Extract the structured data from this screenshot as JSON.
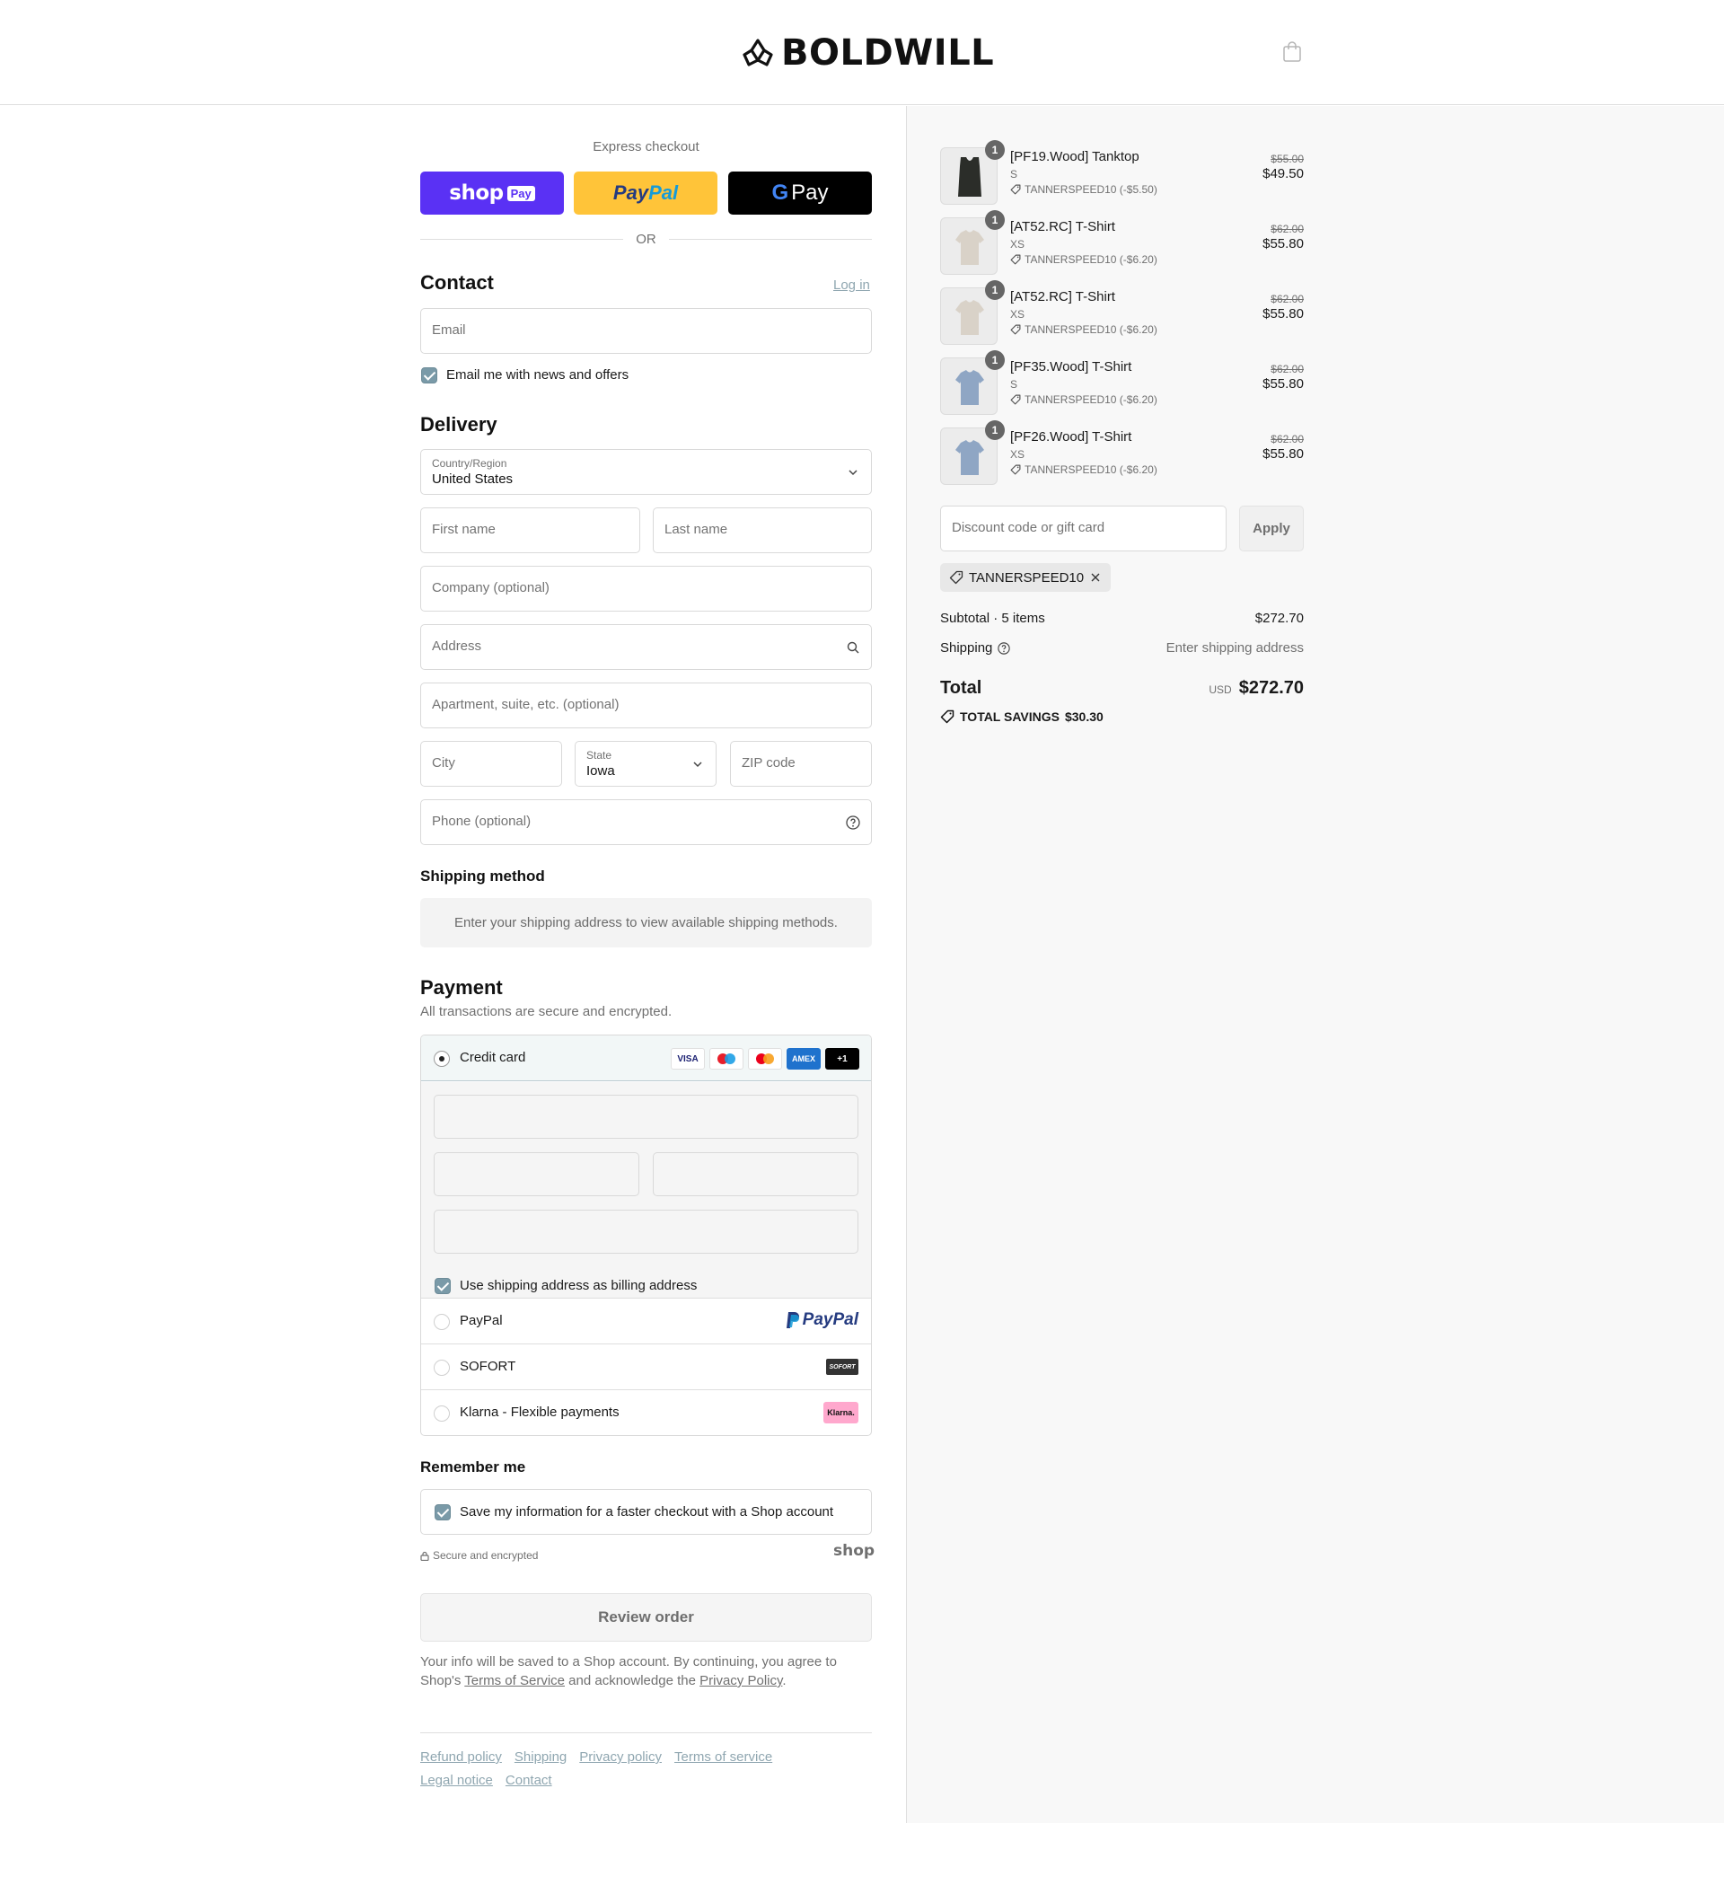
{
  "header": {
    "brand": "BOLDWILL",
    "cart_icon": "shopping-bag-icon"
  },
  "express": {
    "title": "Express checkout",
    "shop_pay": {
      "word": "shop",
      "tag": "Pay",
      "color": "#5a31f4"
    },
    "paypal": {
      "part1": "Pay",
      "part2": "Pal",
      "color": "#ffc439"
    },
    "gpay": {
      "g": "G",
      "word": "Pay",
      "color": "#000000"
    },
    "or": "OR"
  },
  "contact": {
    "title": "Contact",
    "login": "Log in",
    "email_placeholder": "Email",
    "newsletter_label": "Email me with news and offers"
  },
  "delivery": {
    "title": "Delivery",
    "country_label": "Country/Region",
    "country_value": "United States",
    "first_name": "First name",
    "last_name": "Last name",
    "company": "Company (optional)",
    "address": "Address",
    "apartment": "Apartment, suite, etc. (optional)",
    "city": "City",
    "state_label": "State",
    "state_value": "Iowa",
    "zip": "ZIP code",
    "phone": "Phone (optional)"
  },
  "shipping_method": {
    "title": "Shipping method",
    "info": "Enter your shipping address to view available shipping methods."
  },
  "payment": {
    "title": "Payment",
    "subtitle": "All transactions are secure and encrypted.",
    "credit_card": "Credit card",
    "card_badges": [
      "VISA",
      "Maestro",
      "Mastercard",
      "AMEX",
      "+1"
    ],
    "billing_label": "Use shipping address as billing address",
    "paypal": "PayPal",
    "paypal_logo": "PayPal",
    "sofort": "SOFORT",
    "sofort_logo": "SOFORT",
    "klarna": "Klarna - Flexible payments",
    "klarna_logo": "Klarna."
  },
  "remember": {
    "title": "Remember me",
    "label": "Save my information for a faster checkout with a Shop account",
    "secure": "Secure and encrypted",
    "shop": "shop"
  },
  "review_button": "Review order",
  "legal": {
    "part1": "Your info will be saved to a Shop account. By continuing, you agree to Shop's ",
    "tos": "Terms of Service",
    "part2": " and acknowledge the ",
    "privacy": "Privacy Policy",
    "part3": "."
  },
  "footer": {
    "links": [
      "Refund policy",
      "Shipping",
      "Privacy policy",
      "Terms of service",
      "Legal notice",
      "Contact"
    ]
  },
  "summary": {
    "items": [
      {
        "qty": "1",
        "name": "[PF19.Wood] Tanktop",
        "variant": "S",
        "discount": "TANNERSPEED10 (-$5.50)",
        "old_price": "$55.00",
        "price": "$49.50",
        "thumb_color": "#2b2d29",
        "kind": "tank"
      },
      {
        "qty": "1",
        "name": "[AT52.RC] T-Shirt",
        "variant": "XS",
        "discount": "TANNERSPEED10 (-$6.20)",
        "old_price": "$62.00",
        "price": "$55.80",
        "thumb_color": "#d9d2c8",
        "kind": "tee"
      },
      {
        "qty": "1",
        "name": "[AT52.RC] T-Shirt",
        "variant": "XS",
        "discount": "TANNERSPEED10 (-$6.20)",
        "old_price": "$62.00",
        "price": "$55.80",
        "thumb_color": "#d9d2c8",
        "kind": "tee"
      },
      {
        "qty": "1",
        "name": "[PF35.Wood] T-Shirt",
        "variant": "S",
        "discount": "TANNERSPEED10 (-$6.20)",
        "old_price": "$62.00",
        "price": "$55.80",
        "thumb_color": "#8fa6c4",
        "kind": "tee"
      },
      {
        "qty": "1",
        "name": "[PF26.Wood] T-Shirt",
        "variant": "XS",
        "discount": "TANNERSPEED10 (-$6.20)",
        "old_price": "$62.00",
        "price": "$55.80",
        "thumb_color": "#8fa6c4",
        "kind": "tee"
      }
    ],
    "discount_placeholder": "Discount code or gift card",
    "apply": "Apply",
    "applied_code": "TANNERSPEED10",
    "subtotal_label": "Subtotal · 5 items",
    "subtotal_value": "$272.70",
    "shipping_label": "Shipping",
    "shipping_value": "Enter shipping address",
    "total_label": "Total",
    "currency": "USD",
    "total_value": "$272.70",
    "savings_label": "TOTAL SAVINGS",
    "savings_value": "$30.30"
  }
}
